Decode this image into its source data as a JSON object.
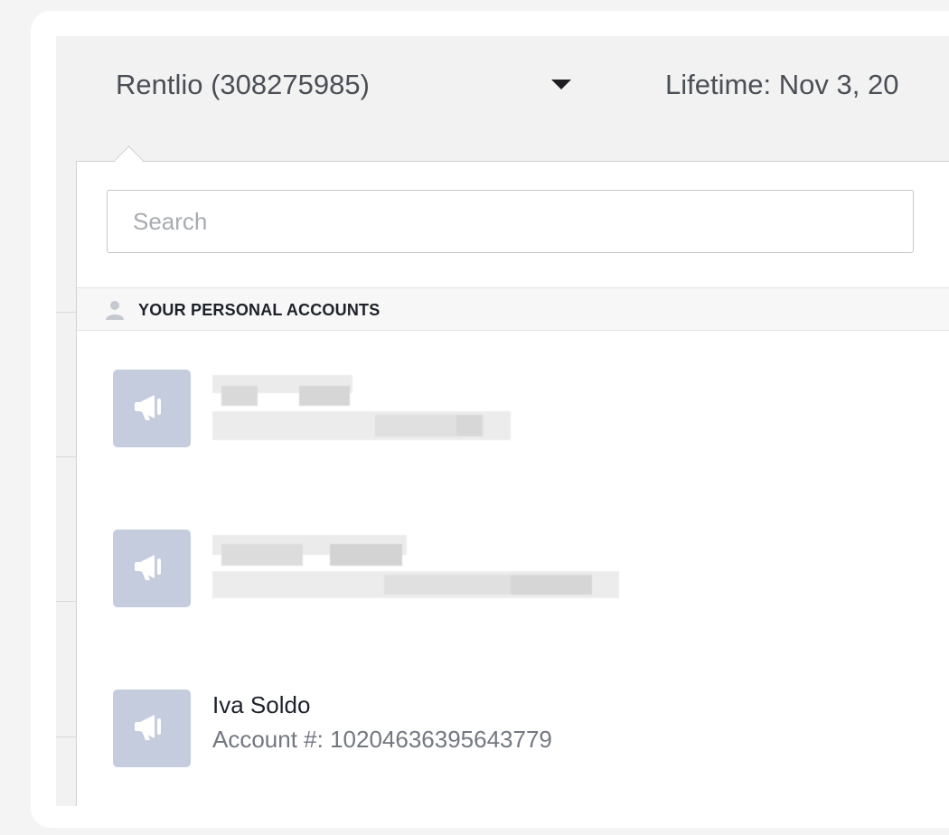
{
  "header": {
    "account_selector": "Rentlio (308275985)",
    "date_range": "Lifetime: Nov 3, 20"
  },
  "dropdown": {
    "search_placeholder": "Search",
    "section_title": "YOUR PERSONAL ACCOUNTS",
    "accounts": [
      {
        "name": "",
        "account_number": "",
        "obscured": true
      },
      {
        "name": "",
        "account_number": "",
        "obscured": true
      },
      {
        "name": "Iva Soldo",
        "account_number": "Account #: 10204636395643779",
        "obscured": false
      }
    ]
  },
  "icons": {
    "caret": "caret-down-icon",
    "person": "person-icon",
    "account": "megaphone-icon"
  },
  "colors": {
    "account_icon_bg": "#c5ccde",
    "section_bg": "#f7f7f7"
  }
}
